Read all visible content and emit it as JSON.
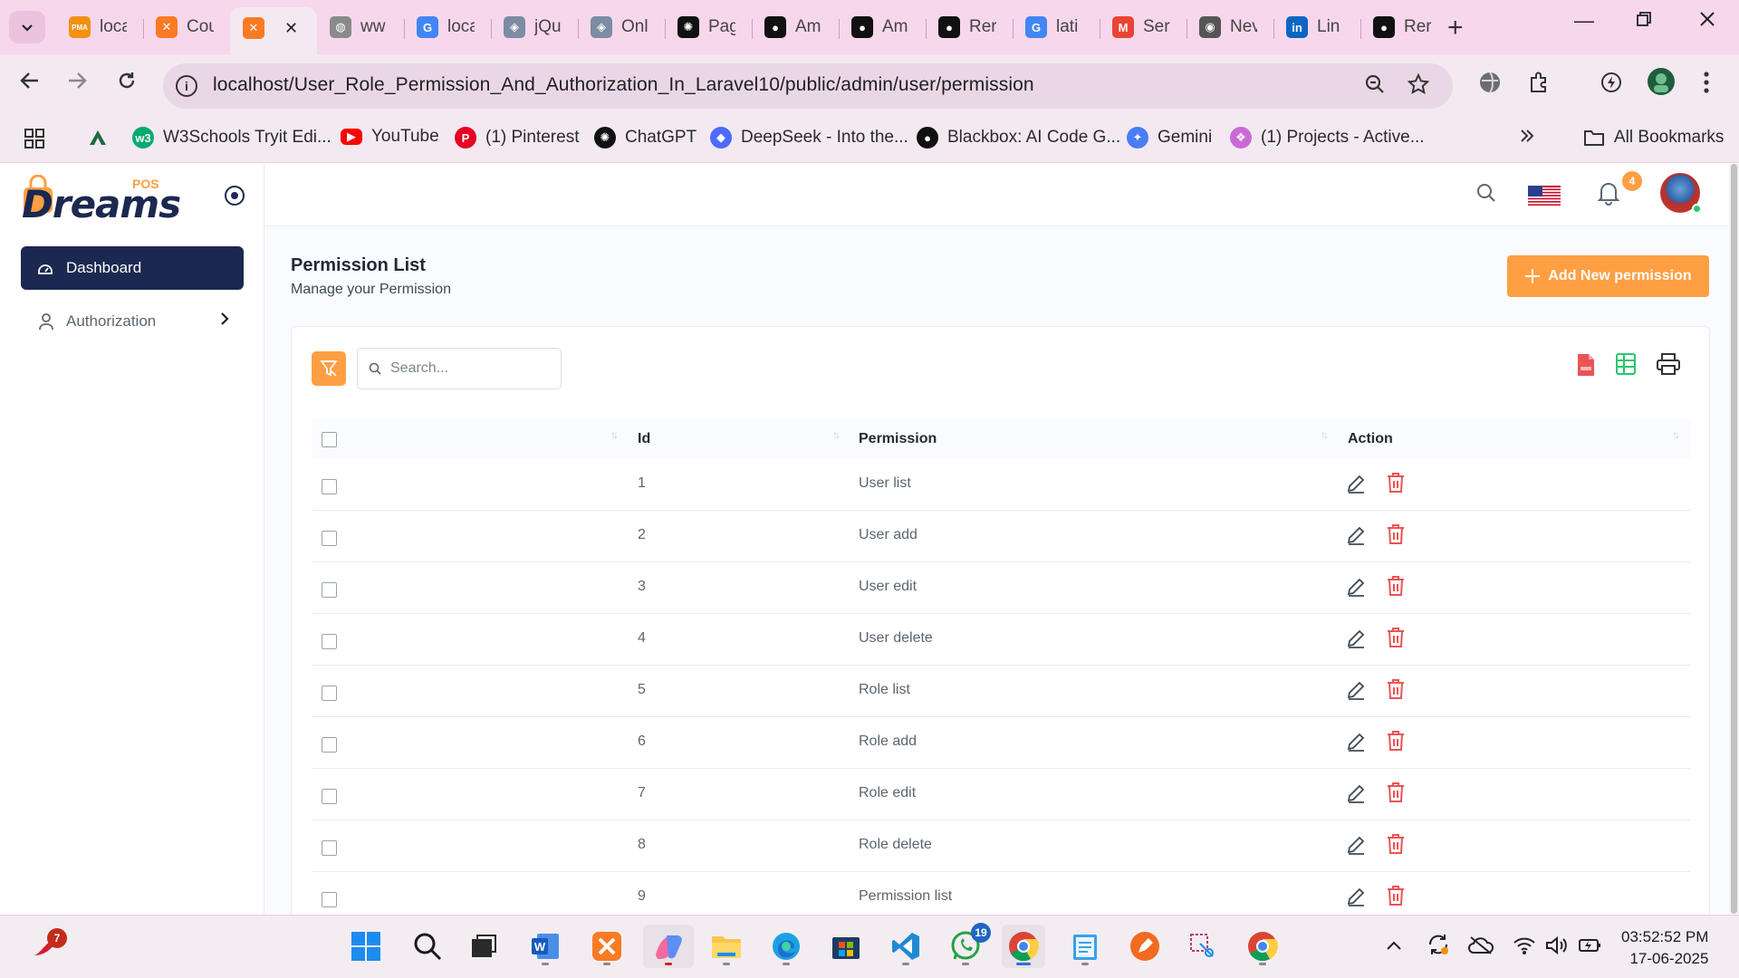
{
  "browser": {
    "tabs": [
      {
        "icon": "phpmyadmin-icon",
        "title": "loca",
        "color": "#f29111"
      },
      {
        "icon": "xampp-icon",
        "title": "Cou",
        "color": "#fb7a24"
      },
      {
        "icon": "xampp-icon",
        "title": "",
        "color": "#fb7a24",
        "active": true
      },
      {
        "icon": "globe-icon",
        "title": "ww",
        "color": "#8a8a8a"
      },
      {
        "icon": "google-icon",
        "title": "loca",
        "color": "#4285f4"
      },
      {
        "icon": "jquery-icon",
        "title": "jQu",
        "color": "#7b8ca3"
      },
      {
        "icon": "jquery-icon",
        "title": "Onl",
        "color": "#7b8ca3"
      },
      {
        "icon": "chatgpt-icon",
        "title": "Pag",
        "color": "#111111"
      },
      {
        "icon": "github-icon",
        "title": "Am",
        "color": "#111111"
      },
      {
        "icon": "github-icon",
        "title": "Am",
        "color": "#111111"
      },
      {
        "icon": "github-icon",
        "title": "Rer",
        "color": "#111111"
      },
      {
        "icon": "google-icon",
        "title": "lati",
        "color": "#4285f4"
      },
      {
        "icon": "gmail-icon",
        "title": "Ser",
        "color": "#ea4335"
      },
      {
        "icon": "chrome-icon",
        "title": "Nev",
        "color": "#555555"
      },
      {
        "icon": "linkedin-icon",
        "title": "Lin",
        "color": "#0a66c2"
      },
      {
        "icon": "github-icon",
        "title": "Rer",
        "color": "#111111"
      }
    ],
    "url": "localhost/User_Role_Permission_And_Authorization_In_Laravel10/public/admin/user/permission",
    "bookmarks": [
      {
        "icon": "w3schools-icon",
        "label": "W3Schools Tryit Edi...",
        "color": "#04aa6d"
      },
      {
        "icon": "youtube-icon",
        "label": "YouTube",
        "color": "#ff0000"
      },
      {
        "icon": "pinterest-icon",
        "label": "(1) Pinterest",
        "color": "#e60023"
      },
      {
        "icon": "chatgpt-icon",
        "label": "ChatGPT",
        "color": "#111111"
      },
      {
        "icon": "deepseek-icon",
        "label": "DeepSeek - Into the...",
        "color": "#4d6bfe"
      },
      {
        "icon": "blackbox-icon",
        "label": "Blackbox: AI Code G...",
        "color": "#111111"
      },
      {
        "icon": "gemini-icon",
        "label": "Gemini",
        "color": "#4a7cf5"
      },
      {
        "icon": "projects-icon",
        "label": "(1) Projects - Active...",
        "color": "#c96bd6"
      }
    ],
    "all_bookmarks": "All Bookmarks"
  },
  "app": {
    "logo": {
      "text": "Dreams",
      "pos": "POS"
    },
    "sidebar": {
      "items": [
        {
          "label": "Dashboard",
          "icon": "dashboard-icon",
          "active": true
        },
        {
          "label": "Authorization",
          "icon": "user-icon"
        }
      ]
    },
    "header": {
      "notification_count": "4"
    },
    "page": {
      "title": "Permission List",
      "subtitle": "Manage your Permission",
      "add_button": "Add New permission"
    },
    "search": {
      "placeholder": "Search..."
    },
    "table": {
      "columns": [
        "Id",
        "Permission",
        "Action"
      ],
      "rows": [
        {
          "id": "1",
          "permission": "User list"
        },
        {
          "id": "2",
          "permission": "User add"
        },
        {
          "id": "3",
          "permission": "User edit"
        },
        {
          "id": "4",
          "permission": "User delete"
        },
        {
          "id": "5",
          "permission": "Role list"
        },
        {
          "id": "6",
          "permission": "Role add"
        },
        {
          "id": "7",
          "permission": "Role edit"
        },
        {
          "id": "8",
          "permission": "Role delete"
        },
        {
          "id": "9",
          "permission": "Permission list"
        }
      ]
    },
    "colors": {
      "accent": "#ff9f43",
      "primary": "#1b2850",
      "danger": "#ea5455"
    }
  },
  "taskbar": {
    "notification_badge": "7",
    "whatsapp_badge": "19",
    "time": "03:52:52 PM",
    "date": "17-06-2025"
  }
}
